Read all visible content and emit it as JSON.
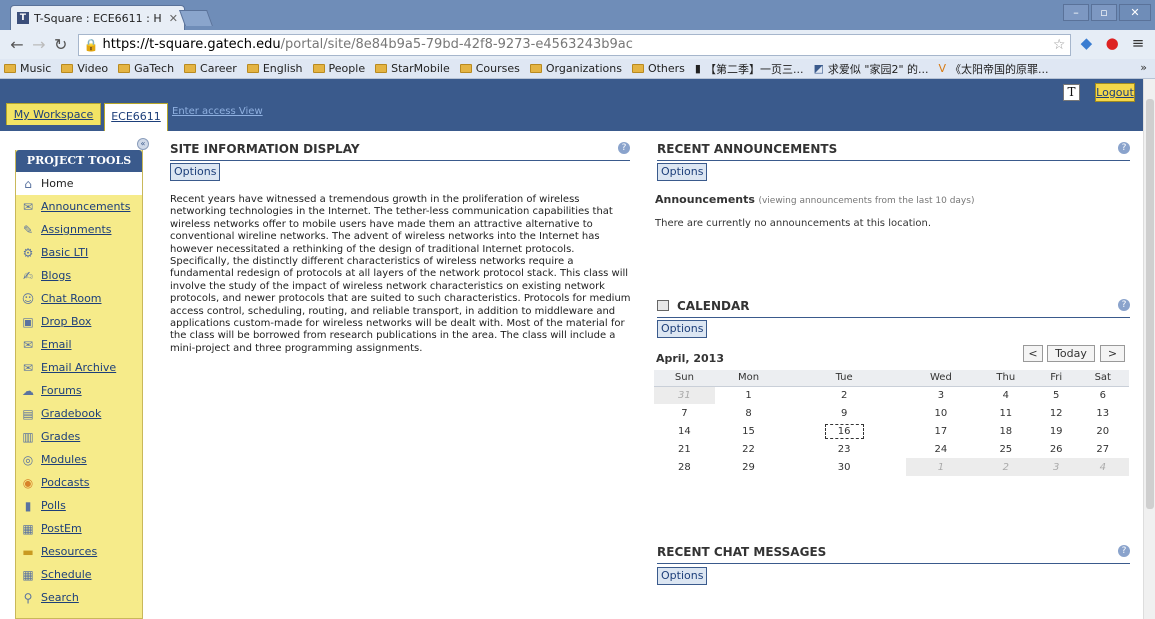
{
  "browser": {
    "tab_title": "T-Square : ECE6611 : H",
    "url_host": "https://t-square.gatech.edu",
    "url_path": "/portal/site/8e84b9a5-79bd-42f8-9273-e4563243b9ac",
    "bookmarks": [
      "Music",
      "Video",
      "GaTech",
      "Career",
      "English",
      "People",
      "StarMobile",
      "Courses",
      "Organizations",
      "Others",
      "【第二季】一页三...",
      "求爱似 \"家园2\" 的...",
      "《太阳帝国的原罪..."
    ]
  },
  "header": {
    "workspace_tab": "My Workspace",
    "site_tab": "ECE6611",
    "access_link": "Enter access View",
    "logout": "Logout"
  },
  "tools": {
    "heading": "PROJECT TOOLS",
    "items": [
      "Home",
      "Announcements",
      "Assignments",
      "Basic LTI",
      "Blogs",
      "Chat Room",
      "Drop Box",
      "Email",
      "Email Archive",
      "Forums",
      "Gradebook",
      "Grades",
      "Modules",
      "Podcasts",
      "Polls",
      "PostEm",
      "Resources",
      "Schedule",
      "Search"
    ]
  },
  "site_info": {
    "title": "SITE INFORMATION DISPLAY",
    "options": "Options",
    "description": "Recent years have witnessed a tremendous growth in the proliferation of wireless networking technologies in the Internet. The tether-less communication capabilities that wireless networks offer to mobile users have made them an attractive alternative to conventional wireline networks. The advent of wireless networks into the Internet has however necessitated a rethinking of the design of traditional Internet protocols. Specifically, the distinctly different characteristics of wireless networks require a fundamental redesign of protocols at all layers of the network protocol stack. This class will involve the study of the impact of wireless network characteristics on existing network protocols, and newer protocols that are suited to such characteristics. Protocols for medium access control, scheduling, routing, and reliable transport, in addition to middleware and applications custom-made for wireless networks will be dealt with. Most of the material for the class will be borrowed from research publications in the area. The class will include a mini-project and three programming assignments."
  },
  "announcements": {
    "title": "RECENT ANNOUNCEMENTS",
    "options": "Options",
    "heading": "Announcements",
    "subheading": "(viewing announcements from the last 10 days)",
    "empty": "There are currently no announcements at this location."
  },
  "calendar": {
    "title": "CALENDAR",
    "options": "Options",
    "month": "April, 2013",
    "prev": "<",
    "today": "Today",
    "next": ">",
    "days": [
      "Sun",
      "Mon",
      "Tue",
      "Wed",
      "Thu",
      "Fri",
      "Sat"
    ],
    "weeks": [
      [
        "31",
        "1",
        "2",
        "3",
        "4",
        "5",
        "6"
      ],
      [
        "7",
        "8",
        "9",
        "10",
        "11",
        "12",
        "13"
      ],
      [
        "14",
        "15",
        "16",
        "17",
        "18",
        "19",
        "20"
      ],
      [
        "21",
        "22",
        "23",
        "24",
        "25",
        "26",
        "27"
      ],
      [
        "28",
        "29",
        "30",
        "1",
        "2",
        "3",
        "4"
      ]
    ]
  },
  "chat": {
    "title": "RECENT CHAT MESSAGES",
    "options": "Options"
  }
}
